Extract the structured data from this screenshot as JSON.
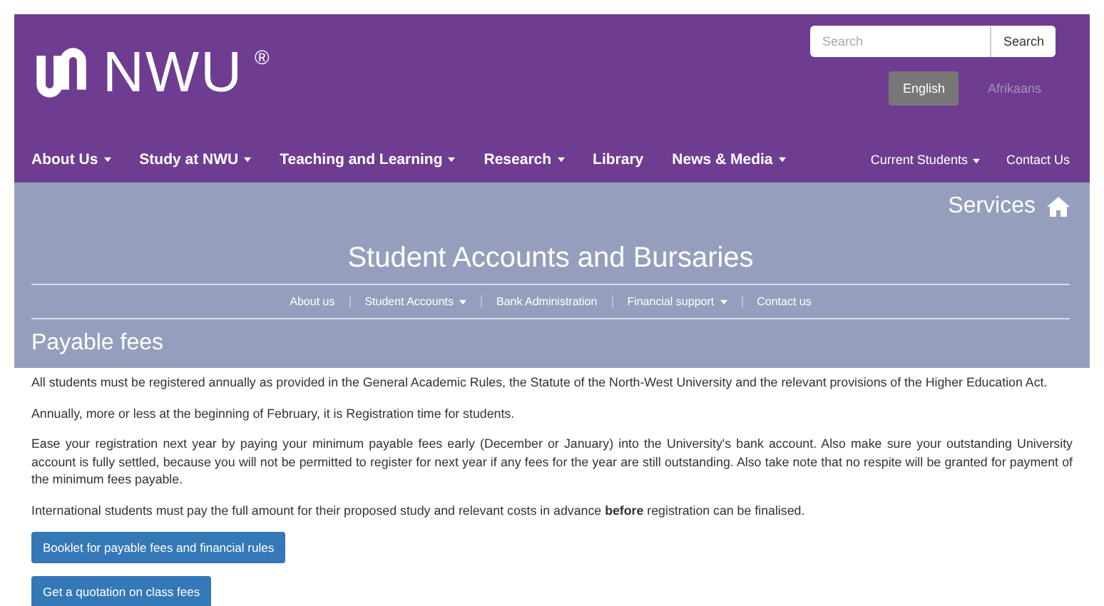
{
  "header": {
    "logo_text": "NWU",
    "logo_mark": "®",
    "search": {
      "placeholder": "Search",
      "button": "Search"
    },
    "languages": [
      {
        "label": "English",
        "selected": true
      },
      {
        "label": "Afrikaans",
        "selected": false
      }
    ],
    "nav": [
      {
        "label": "About Us",
        "has_menu": true
      },
      {
        "label": "Study at NWU",
        "has_menu": true
      },
      {
        "label": "Teaching and Learning",
        "has_menu": true
      },
      {
        "label": "Research",
        "has_menu": true
      },
      {
        "label": "Library",
        "has_menu": false
      },
      {
        "label": "News & Media",
        "has_menu": true
      }
    ],
    "nav_right": [
      {
        "label": "Current Students",
        "has_menu": true
      },
      {
        "label": "Contact Us",
        "has_menu": false
      }
    ]
  },
  "banner": {
    "services": "Services",
    "title": "Student Accounts and Bursaries",
    "subnav": [
      {
        "label": "About us",
        "has_menu": false
      },
      {
        "label": "Student Accounts",
        "has_menu": true
      },
      {
        "label": "Bank Administration",
        "has_menu": false
      },
      {
        "label": "Financial support",
        "has_menu": true
      },
      {
        "label": "Contact us",
        "has_menu": false
      }
    ],
    "page_title": "Payable fees"
  },
  "content": {
    "paragraphs": [
      "All students must be registered annually as provided in the General Academic Rules, the Statute of the North-West University and the relevant provisions of the Higher Education Act.",
      "Annually, more or less at the beginning of February, it is Registration time for students.",
      "Ease your registration next year by paying your minimum payable fees early (December or January) into the University's bank account. Also make sure your outstanding University account is fully settled, because you will not be permitted to register for next year if any fees for the year are still outstanding. Also take note that no respite will be granted for payment of the minimum fees payable.",
      "International students must pay the full amount for their proposed study and relevant costs in advance **before** registration can be finalised."
    ],
    "buttons": [
      "Booklet for payable fees and financial rules",
      "Get a quotation on class fees"
    ]
  }
}
